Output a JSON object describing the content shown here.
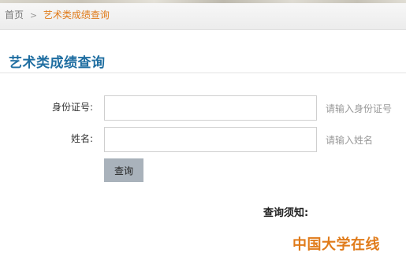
{
  "breadcrumb": {
    "home": "首页",
    "separator": ">",
    "current": "艺术类成绩查询"
  },
  "page": {
    "title": "艺术类成绩查询"
  },
  "form": {
    "id_label": "身份证号:",
    "id_value": "",
    "id_hint": "请输入身份证号",
    "name_label": "姓名:",
    "name_value": "",
    "name_hint": "请输入姓名",
    "submit_label": "查询"
  },
  "notice": {
    "title": "查询须知:"
  },
  "branding": {
    "logo_text": "中国大学在线",
    "accent_color": "#e07b1a",
    "title_color": "#1f6ea1"
  }
}
